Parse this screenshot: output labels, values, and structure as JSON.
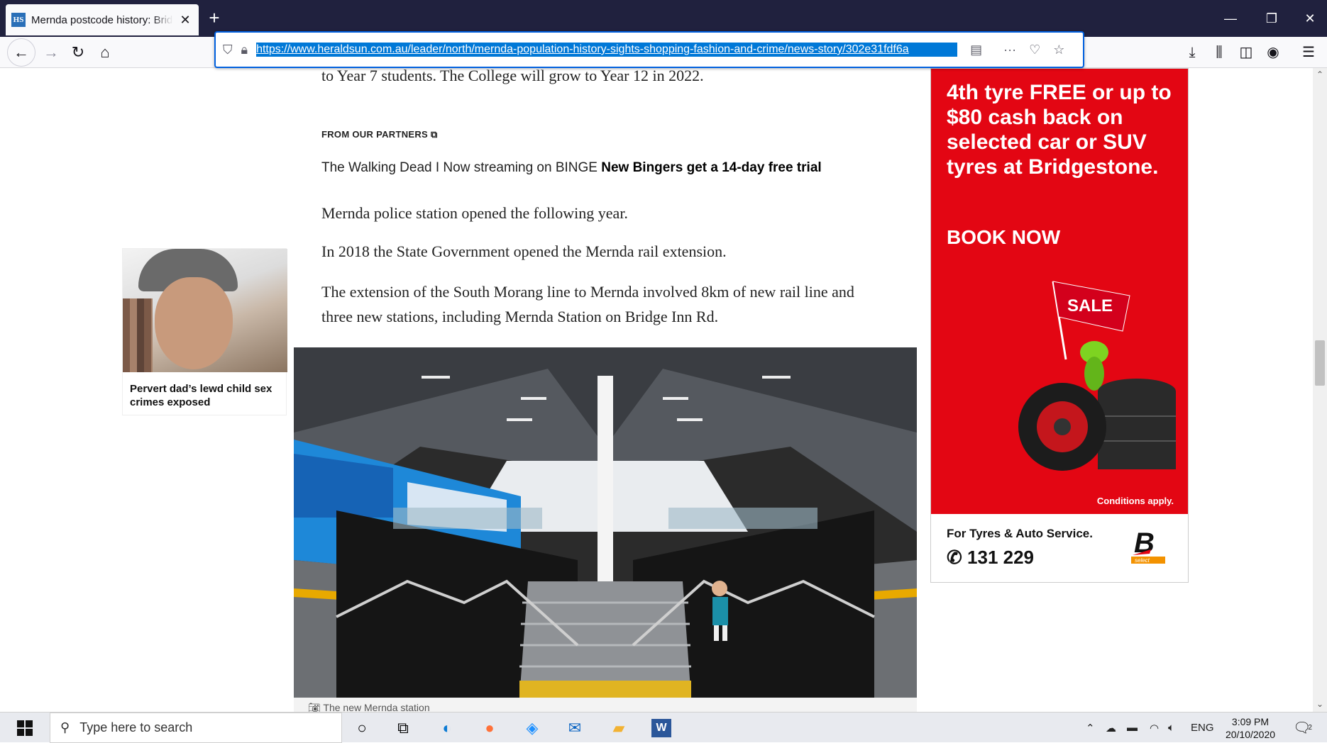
{
  "browser": {
    "tab_title": "Mernda postcode history: Bridge Inn Rd",
    "favicon_text": "HS",
    "url": "https://www.heraldsun.com.au/leader/north/mernda-population-history-sights-shopping-fashion-and-crime/news-story/302e31fdf6a"
  },
  "article": {
    "para_top": "to Year 7 students. The College will grow to Year 12 in 2022.",
    "partners_label": "FROM OUR PARTNERS",
    "partners_text": "The Walking Dead I Now streaming on BINGE",
    "partners_bold": "New Bingers get a 14-day free trial",
    "para1": "Mernda police station opened the following year.",
    "para2": "In 2018 the State Government opened the Mernda rail extension.",
    "para3": "The extension of the South Morang line to Mernda involved 8km of new rail line and three new stations, including Mernda Station on Bridge Inn Rd.",
    "photo_caption": "The new Mernda station"
  },
  "related_card": {
    "headline": "Pervert dad’s lewd child sex crimes exposed"
  },
  "ad": {
    "headline": "4th tyre FREE or up to $80 cash back on selected car or SUV tyres at Bridgestone.",
    "cta": "BOOK NOW",
    "flag": "SALE",
    "conditions": "Conditions apply.",
    "service": "For Tyres & Auto Service.",
    "phone": "131 229",
    "brand_small": "select"
  },
  "taskbar": {
    "search_placeholder": "Type here to search",
    "language": "ENG",
    "time": "3:09 PM",
    "date": "20/10/2020",
    "notification_count": "2"
  },
  "colors": {
    "tabbar": "#20213e",
    "url_highlight": "#0078d7",
    "ad_red": "#e30613"
  }
}
